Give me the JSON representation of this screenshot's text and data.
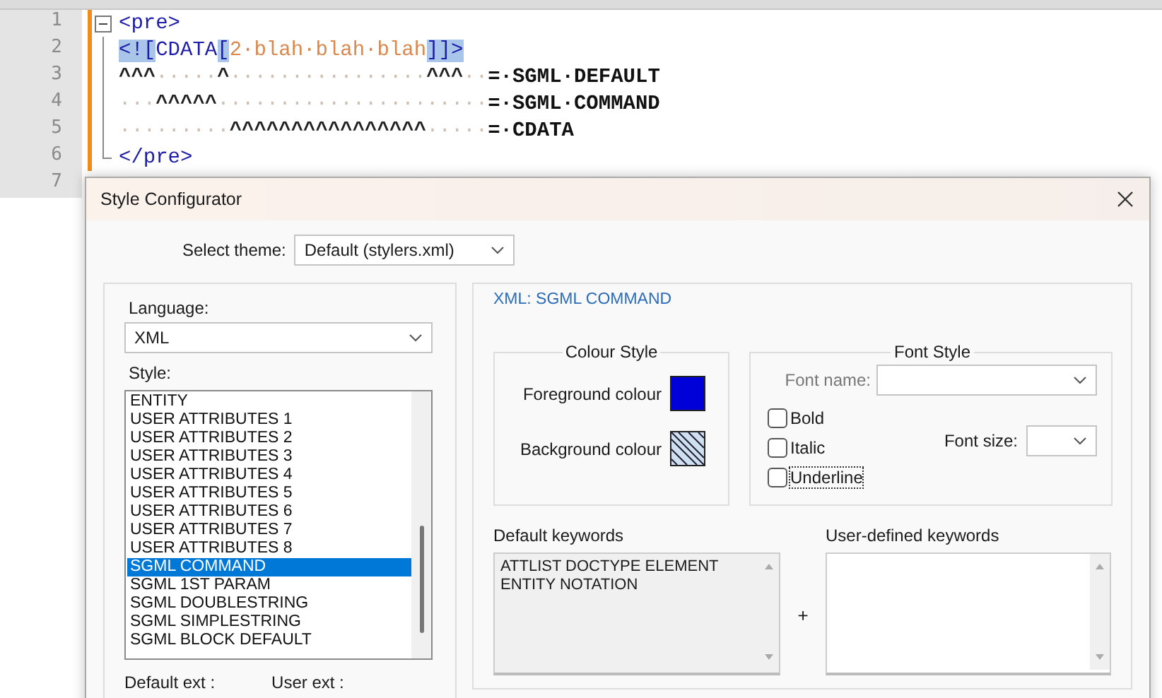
{
  "editor": {
    "lines": [
      {
        "number": "1",
        "kind": "fold-start",
        "modified": true,
        "segments": [
          {
            "kind": "tag",
            "text": "<pre>"
          }
        ]
      },
      {
        "number": "2",
        "kind": "fold-body",
        "modified": true,
        "segments": [
          {
            "kind": "tag-highlight",
            "text": "<!["
          },
          {
            "kind": "tag",
            "text": "CDATA"
          },
          {
            "kind": "tag-highlight",
            "text": "["
          },
          {
            "kind": "content",
            "text": "2·blah·blah·blah"
          },
          {
            "kind": "tag-highlight",
            "text": "]]>"
          }
        ]
      },
      {
        "number": "3",
        "kind": "fold-body",
        "modified": true,
        "segments": [
          {
            "kind": "marker",
            "text": "^^^"
          },
          {
            "kind": "whitespace",
            "text": "·····"
          },
          {
            "kind": "marker",
            "text": "^"
          },
          {
            "kind": "whitespace",
            "text": "················"
          },
          {
            "kind": "marker",
            "text": "^^^"
          },
          {
            "kind": "whitespace",
            "text": "··"
          },
          {
            "kind": "label",
            "text": "=·SGML·DEFAULT"
          }
        ]
      },
      {
        "number": "4",
        "kind": "fold-body",
        "modified": true,
        "segments": [
          {
            "kind": "whitespace",
            "text": "···"
          },
          {
            "kind": "marker",
            "text": "^^^^^"
          },
          {
            "kind": "whitespace",
            "text": "······················"
          },
          {
            "kind": "label",
            "text": "=·SGML·COMMAND"
          }
        ]
      },
      {
        "number": "5",
        "kind": "fold-body",
        "modified": true,
        "segments": [
          {
            "kind": "whitespace",
            "text": "·········"
          },
          {
            "kind": "marker",
            "text": "^^^^^^^^^^^^^^^^"
          },
          {
            "kind": "whitespace",
            "text": "·····"
          },
          {
            "kind": "label",
            "text": "=·CDATA"
          }
        ]
      },
      {
        "number": "6",
        "kind": "fold-end",
        "modified": true,
        "segments": [
          {
            "kind": "tag",
            "text": "</pre>"
          }
        ]
      },
      {
        "number": "7",
        "kind": "plain",
        "modified": false
      }
    ]
  },
  "dialog": {
    "title": "Style Configurator",
    "theme": {
      "label": "Select theme:",
      "value": "Default (stylers.xml)"
    },
    "language": {
      "label": "Language:",
      "value": "XML"
    },
    "style_label": "Style:",
    "styles": [
      {
        "label": "ENTITY",
        "selected": false
      },
      {
        "label": "USER ATTRIBUTES 1",
        "selected": false
      },
      {
        "label": "USER ATTRIBUTES 2",
        "selected": false
      },
      {
        "label": "USER ATTRIBUTES 3",
        "selected": false
      },
      {
        "label": "USER ATTRIBUTES 4",
        "selected": false
      },
      {
        "label": "USER ATTRIBUTES 5",
        "selected": false
      },
      {
        "label": "USER ATTRIBUTES 6",
        "selected": false
      },
      {
        "label": "USER ATTRIBUTES 7",
        "selected": false
      },
      {
        "label": "USER ATTRIBUTES 8",
        "selected": false
      },
      {
        "label": "SGML COMMAND",
        "selected": true
      },
      {
        "label": "SGML 1ST PARAM",
        "selected": false
      },
      {
        "label": "SGML DOUBLESTRING",
        "selected": false
      },
      {
        "label": "SGML SIMPLESTRING",
        "selected": false
      },
      {
        "label": "SGML BLOCK DEFAULT",
        "selected": false
      }
    ],
    "default_ext_label": "Default ext :",
    "user_ext_label": "User ext :",
    "heading": "XML: SGML COMMAND",
    "colour_style": {
      "title": "Colour Style",
      "swatches": [
        {
          "label": "Foreground colour",
          "kind": "solid",
          "color": "#0000d8"
        },
        {
          "label": "Background colour",
          "kind": "transparent"
        }
      ]
    },
    "font_style": {
      "title": "Font Style",
      "font_name_label": "Font name:",
      "font_size_label": "Font size:",
      "options": [
        {
          "label": "Bold",
          "checked": false,
          "focused": false
        },
        {
          "label": "Italic",
          "checked": false,
          "focused": false
        },
        {
          "label": "Underline",
          "checked": false,
          "focused": true
        }
      ]
    },
    "default_keywords": {
      "label": "Default keywords",
      "value": "ATTLIST DOCTYPE ELEMENT ENTITY NOTATION"
    },
    "plus": "+",
    "user_keywords": {
      "label": "User-defined keywords"
    }
  }
}
